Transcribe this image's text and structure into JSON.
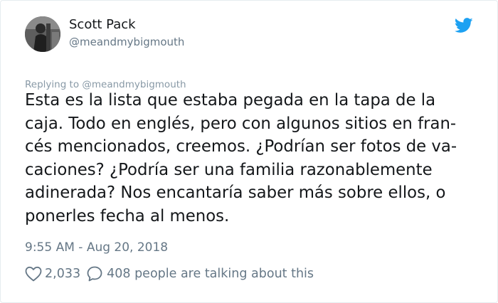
{
  "tweet": {
    "author": {
      "display_name": "Scott Pack",
      "handle": "@meandmybigmouth",
      "avatar_icon": "avatar-photo"
    },
    "reply_to": "Replying to @meandmybigmouth",
    "text": "Esta es la lista que estaba pegada en la tapa de la\ncaja. Todo en englés, pero con algunos sitios en fran-\ncés mencionados, creemos. ¿Podrían ser fotos de va-\ncaciones? ¿Podría ser una familia razonablemente\nadinerada? Nos encantaría saber más sobre ellos, o\nponerles fecha al menos.",
    "timestamp": "9:55 AM - Aug 20, 2018",
    "likes": "2,033",
    "talking": "408 people are talking about this"
  },
  "icons": {
    "brand": "twitter-bird-icon",
    "like": "heart-icon",
    "comment": "speech-bubble-icon"
  },
  "colors": {
    "brand": "#1da1f2",
    "secondary_text": "#657786",
    "reply_text": "#8899a6"
  }
}
